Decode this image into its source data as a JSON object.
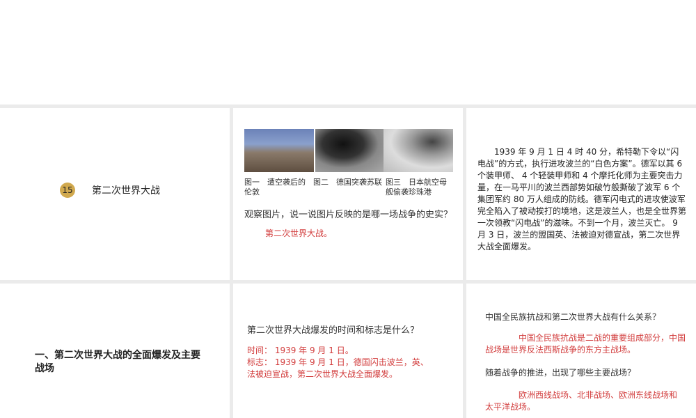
{
  "slide1": {
    "badge": "15",
    "lesson_title": "第二次世界大战",
    "captions": [
      "图一　遭空袭后的伦敦",
      "图二　德国突袭苏联",
      "图三　日本航空母舰偷袭珍珠港"
    ],
    "question": "观察图片，说一说图片反映的是哪一场战争的史实？",
    "answer": "第二次世界大战。",
    "paragraph": "1939 年 9 月 1 日 4 时 40 分，希特勒下令以“闪电战”的方式，执行进攻波兰的“白色方案”。德军以其 6 个装甲师、 4 个轻装甲师和 4 个摩托化师为主要突击力量，在一马平川的波兰西部势如破竹般撕破了波军 6 个集团军约 80 万人组成的防线。德军闪电式的进攻使波军完全陷入了被动挨打的境地，这是波兰人，也是全世界第一次领教“闪电战”的滋味。不到一个月，波兰灭亡。 9 月 3 日，波兰的盟国英、法被迫对德宣战，第二次世界大战全面爆发。"
  },
  "slide2": {
    "section_title": "一、第二次世界大战的全面爆发及主要战场",
    "question": "第二次世界大战爆发的时间和标志是什么？",
    "answer_time": "时间： 1939 年 9 月 1 日。",
    "answer_mark": "标志： 1939 年 9 月 1 日，德国闪击波兰，英、法被迫宣战，第二次世界大战全面爆发。",
    "question2": "中国全民族抗战和第二次世界大战有什么关系？",
    "answer2": "中国全民族抗战是二战的重要组成部分，中国战场是世界反法西斯战争的东方主战场。",
    "question3": "随着战争的推进，出现了哪些主要战场？",
    "answer3": "欧洲西线战场、北非战场、欧洲东线战场和太平洋战场。"
  }
}
